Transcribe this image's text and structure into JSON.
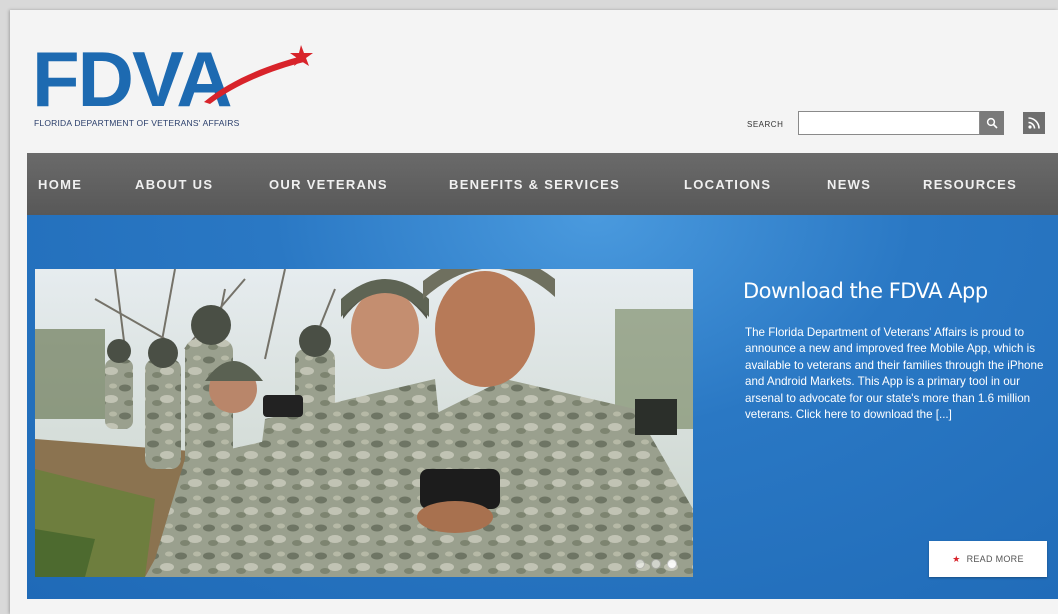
{
  "brand": {
    "logo_text": "FDVA",
    "tagline": "FLORIDA DEPARTMENT OF VETERANS' AFFAIRS",
    "colors": {
      "blue": "#1d6ab1",
      "red": "#d8232a"
    }
  },
  "search": {
    "label": "SEARCH",
    "value": "",
    "placeholder": "",
    "button_icon": "search-icon",
    "rss_icon": "rss-icon"
  },
  "nav": {
    "items": [
      {
        "label": "HOME"
      },
      {
        "label": "ABOUT US"
      },
      {
        "label": "OUR VETERANS"
      },
      {
        "label": "BENEFITS & SERVICES"
      },
      {
        "label": "LOCATIONS"
      },
      {
        "label": "NEWS"
      },
      {
        "label": "RESOURCES"
      }
    ],
    "background": "#616161"
  },
  "hero": {
    "title": "Download the FDVA App",
    "body": "The Florida Department of Veterans' Affairs is proud to announce a new and improved free Mobile App, which is available to veterans and their families through the iPhone and Android Markets.  This App is a primary tool in our arsenal to advocate for our state's more than 1.6 million veterans. Click here to download the [...]",
    "read_more": "READ MORE",
    "slides": {
      "count": 3,
      "active": 3
    },
    "background": "#2474c0"
  }
}
